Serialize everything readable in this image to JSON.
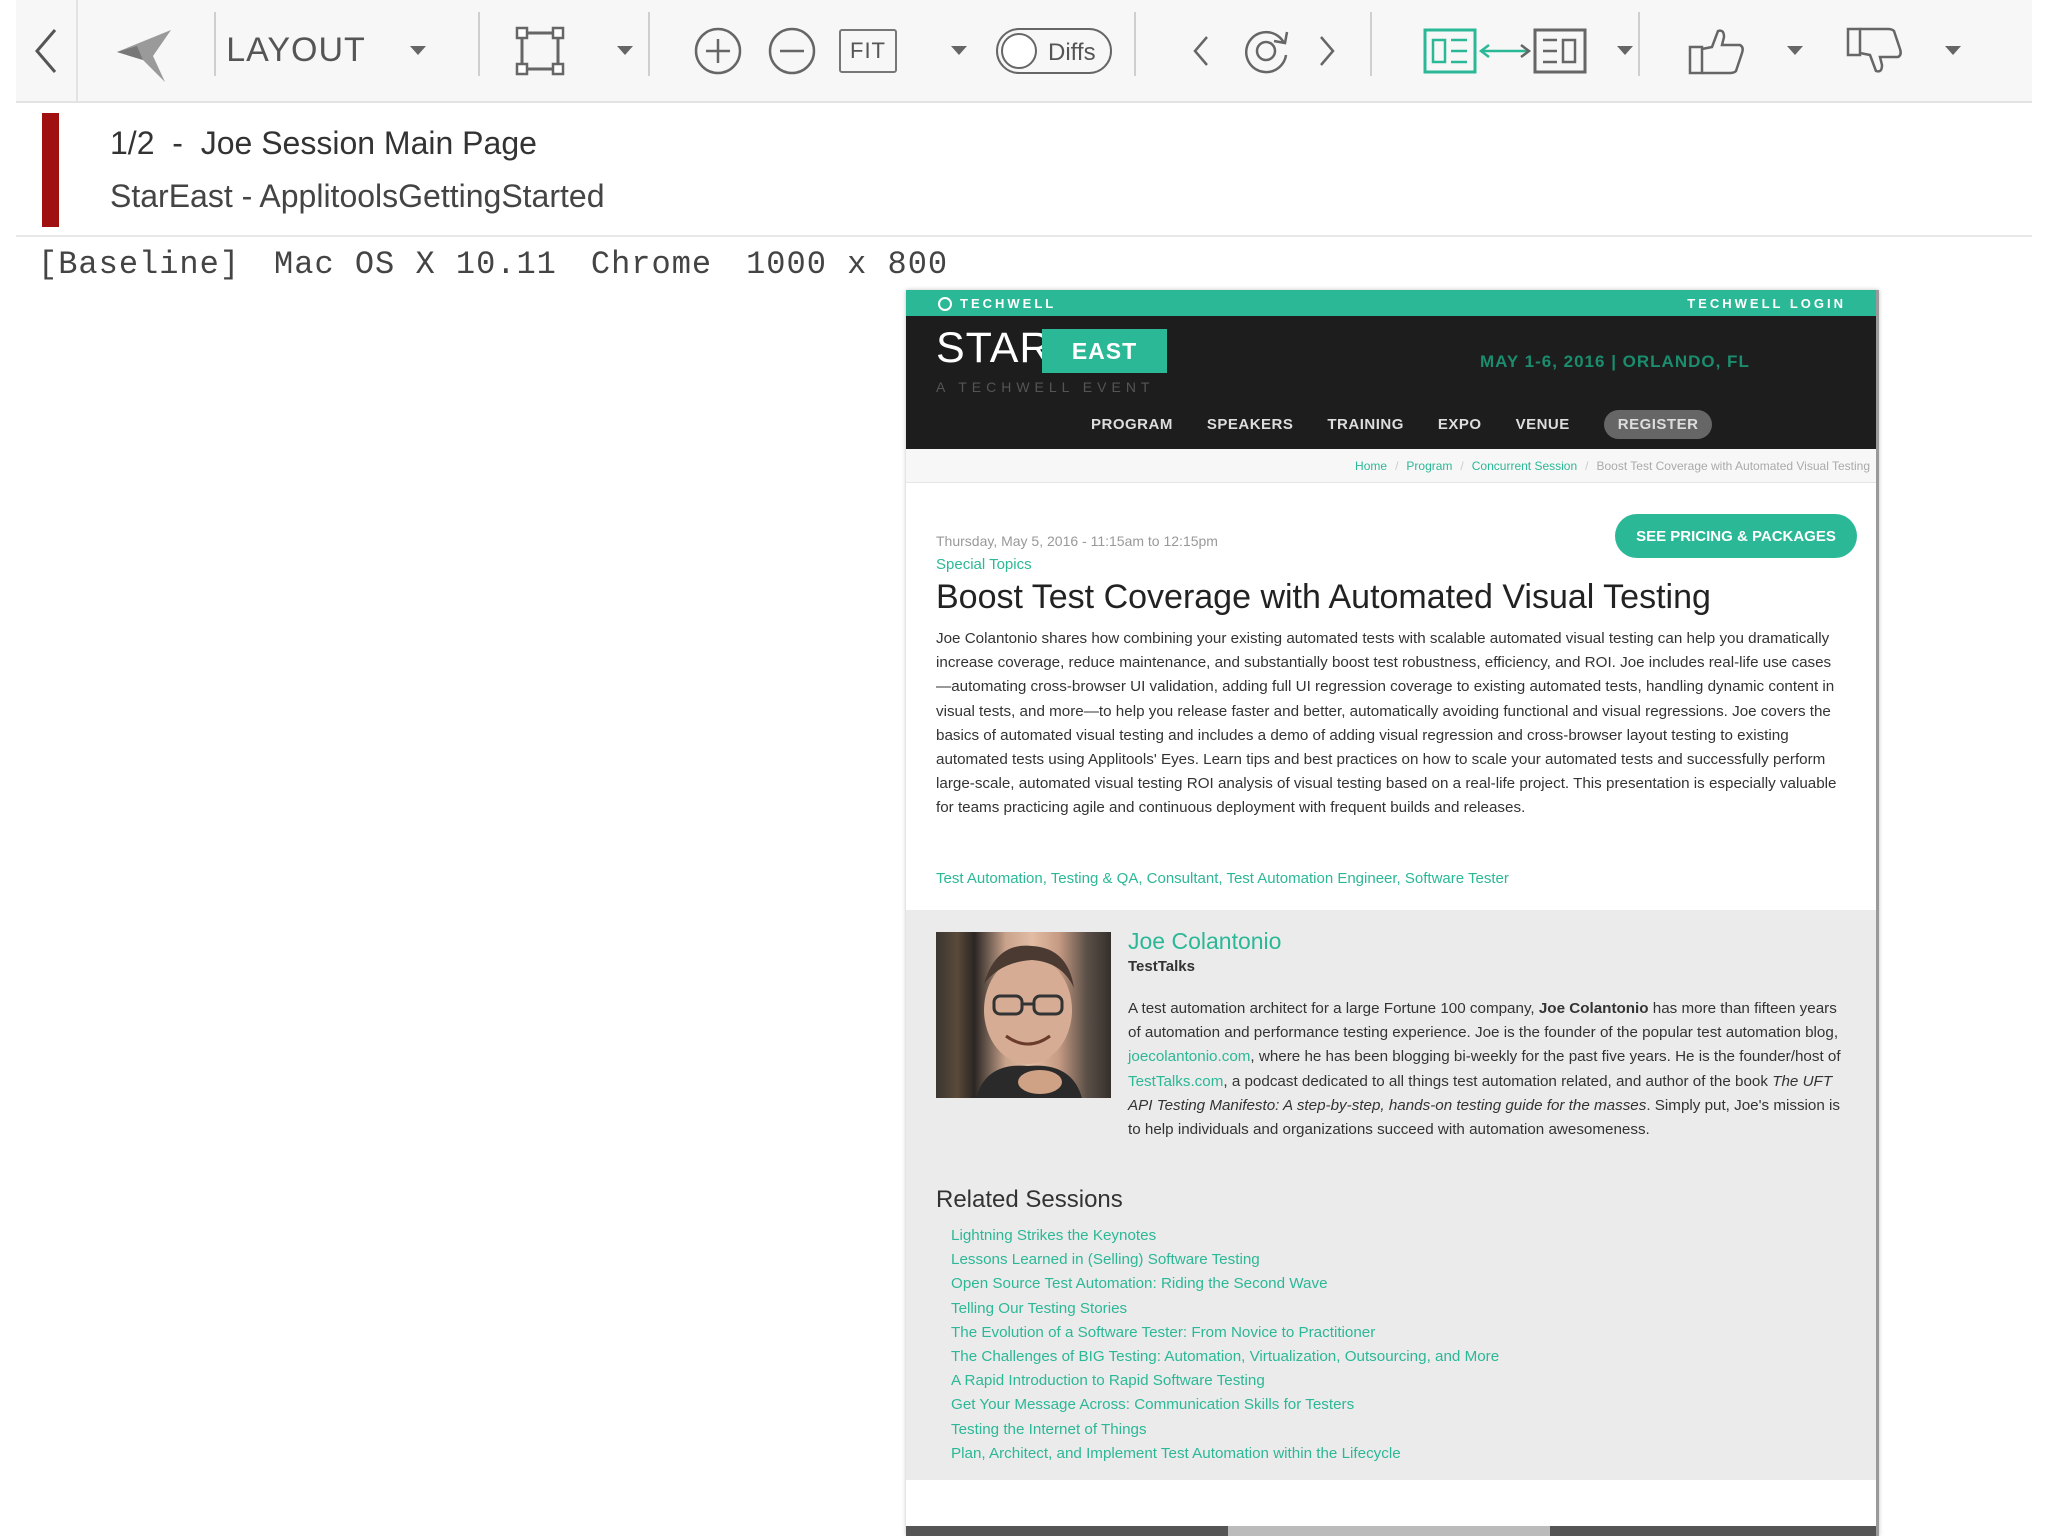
{
  "toolbar": {
    "layout_label": "LAYOUT",
    "fit_label": "FIT",
    "diffs_label": "Diffs"
  },
  "step": {
    "title": "1/2  -  Joe Session Main Page",
    "app_name": "StarEast - ApplitoolsGettingStarted",
    "status_color": "#a01010"
  },
  "environment": {
    "type": "[Baseline]",
    "os": "Mac OS X 10.11",
    "browser": "Chrome",
    "viewport": "1000 x 800"
  },
  "page": {
    "top_bar": {
      "brand": "TECHWELL",
      "login": "TECHWELL LOGIN"
    },
    "header": {
      "star": "STAR",
      "east": "EAST",
      "tagline": "A TECHWELL EVENT",
      "date": "MAY 1-6, 2016 | ORLANDO, FL"
    },
    "nav": [
      "PROGRAM",
      "SPEAKERS",
      "TRAINING",
      "EXPO",
      "VENUE"
    ],
    "nav_register": "REGISTER",
    "breadcrumb": {
      "home": "Home",
      "program": "Program",
      "concurrent": "Concurrent Session",
      "current": "Boost Test Coverage with Automated Visual Testing"
    },
    "pricing_button": "SEE PRICING & PACKAGES",
    "session": {
      "time": "Thursday, May 5, 2016 - 11:15am to 12:15pm",
      "track": "Special Topics",
      "title": "Boost Test Coverage with Automated Visual Testing",
      "description": "Joe Colantonio shares how combining your existing automated tests with scalable automated visual testing can help you dramatically increase coverage, reduce maintenance, and substantially boost test robustness, efficiency, and ROI. Joe includes real-life use cases—automating cross-browser UI validation, adding full UI regression coverage to existing automated tests, handling dynamic content in visual tests, and more—to help you release faster and better, automatically avoiding functional and visual regressions. Joe covers the basics of automated visual testing and includes a demo of adding visual regression and cross-browser layout testing to existing automated tests using Applitools' Eyes. Learn tips and best practices on how to scale your automated tests and successfully perform large-scale, automated visual testing ROI analysis of visual testing based on a real-life project. This presentation is especially valuable for teams practicing agile and continuous deployment with frequent builds and releases.",
      "tags": "Test Automation, Testing & QA, Consultant, Test Automation Engineer, Software Tester"
    },
    "speaker": {
      "name": "Joe Colantonio",
      "company": "TestTalks",
      "bio_1": "A test automation architect for a large Fortune 100 company, ",
      "bio_bold": "Joe Colantonio",
      "bio_2": " has more than fifteen years of automation and performance testing experience. Joe is the founder of the popular test automation blog, ",
      "bio_link_1": "joecolantonio.com",
      "bio_3": ", where he has been blogging bi-weekly for the past five years. He is the founder/host of ",
      "bio_link_2": "TestTalks.com",
      "bio_4": ", a podcast dedicated to all things test automation related, and author of the book ",
      "bio_book": "The UFT API Testing Manifesto: A step-by-step, hands-on testing guide for the masses",
      "bio_5": ". Simply put, Joe's mission is to help individuals and organizations succeed with automation awesomeness."
    },
    "related_title": "Related Sessions",
    "related_sessions": [
      "Lightning Strikes the Keynotes",
      "Lessons Learned in (Selling) Software Testing",
      "Open Source Test Automation: Riding the Second Wave",
      "Telling Our Testing Stories",
      "The Evolution of a Software Tester: From Novice to Practitioner",
      "The Challenges of BIG Testing: Automation, Virtualization, Outsourcing, and More",
      "A Rapid Introduction to Rapid Software Testing",
      "Get Your Message Across: Communication Skills for Testers",
      "Testing the Internet of Things",
      "Plan, Architect, and Implement Test Automation within the Lifecycle"
    ],
    "accent_color": "#2bb896"
  }
}
